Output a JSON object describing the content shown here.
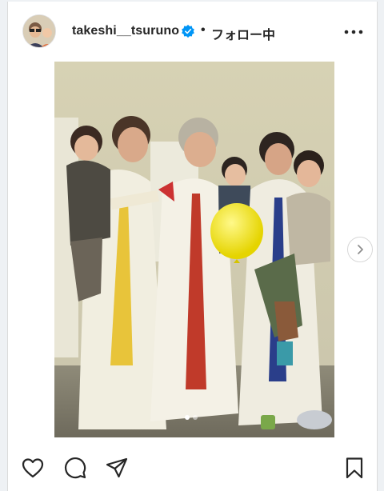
{
  "post": {
    "username": "takeshi__tsuruno",
    "separator": "•",
    "follow_label": "フォロー中"
  },
  "icons": {
    "verified": "verified-badge-icon",
    "more": "more-options-icon",
    "next": "chevron-right-icon",
    "like": "heart-icon",
    "comment": "comment-icon",
    "share": "send-icon",
    "save": "bookmark-icon"
  },
  "carousel": {
    "slide_count": 2,
    "active_slide": 1
  },
  "colors": {
    "verified_blue": "#0095f6",
    "text": "#262626"
  }
}
